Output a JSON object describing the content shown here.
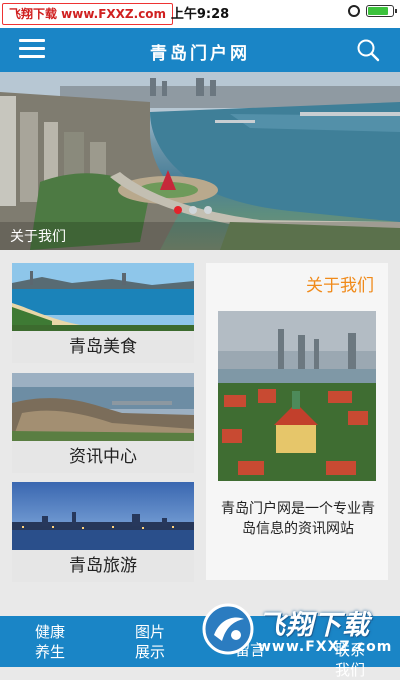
{
  "status_bar": {
    "watermark": "飞翔下载 www.FXXZ.com",
    "time": "上午9:28",
    "battery_level": 0.85
  },
  "header": {
    "title": "青岛门户网",
    "menu_icon": "hamburger-menu-icon",
    "search_icon": "search-icon",
    "color": "#1a85c6"
  },
  "hero": {
    "caption": "关于我们",
    "slides": 3,
    "active_slide": 1
  },
  "cards": [
    {
      "label": "青岛美食"
    },
    {
      "label": "资讯中心"
    },
    {
      "label": "青岛旅游"
    }
  ],
  "about": {
    "title": "关于我们",
    "text": "青岛门户网是一个专业青岛信息的资讯网站",
    "title_color": "#f08a1a"
  },
  "bottom_nav": {
    "items": [
      {
        "label": "健康养生"
      },
      {
        "label": "图片展示"
      },
      {
        "label": "留言"
      },
      {
        "label": "联系我们"
      }
    ]
  },
  "overlay_watermark": {
    "brand": "飞翔下载",
    "url": "www.FXXZ.com"
  }
}
